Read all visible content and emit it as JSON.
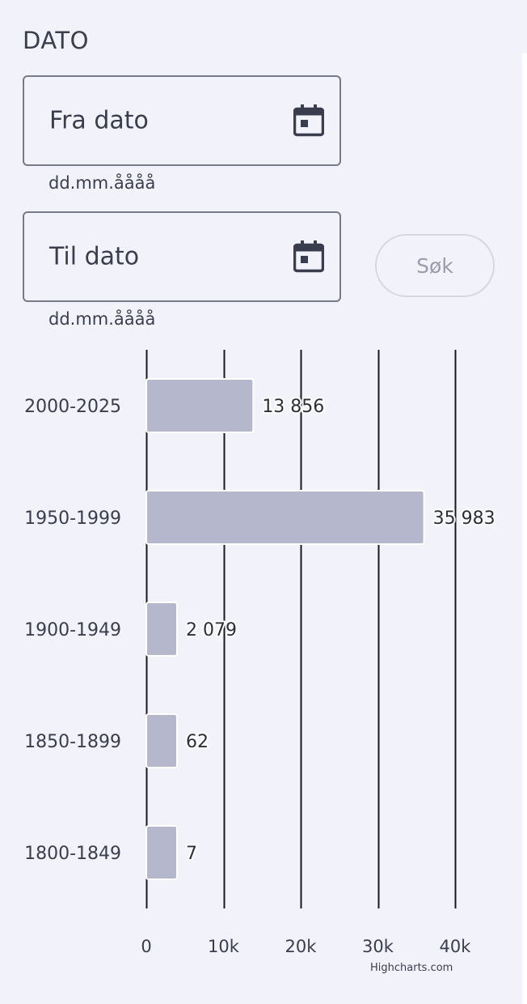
{
  "filter": {
    "section_title": "DATO",
    "from_date": {
      "label": "Fra dato",
      "hint": "dd.mm.åååå",
      "icon": "calendar-icon"
    },
    "to_date": {
      "label": "Til dato",
      "hint": "dd.mm.åååå",
      "icon": "calendar-icon"
    },
    "search_label": "Søk"
  },
  "chart_data": {
    "type": "bar",
    "orientation": "horizontal",
    "categories": [
      "2000-2025",
      "1950-1999",
      "1900-1949",
      "1850-1899",
      "1800-1849"
    ],
    "values": [
      13856,
      35983,
      2079,
      62,
      7
    ],
    "data_labels": [
      "13 856",
      "35 983",
      "2 079",
      "62",
      "7"
    ],
    "xlim": [
      0,
      40000
    ],
    "x_ticks": [
      0,
      10000,
      20000,
      30000,
      40000
    ],
    "x_tick_labels": [
      "0",
      "10k",
      "20k",
      "30k",
      "40k"
    ],
    "grid": true,
    "bar_color": "#b5b8cd",
    "credits": "Highcharts.com"
  }
}
